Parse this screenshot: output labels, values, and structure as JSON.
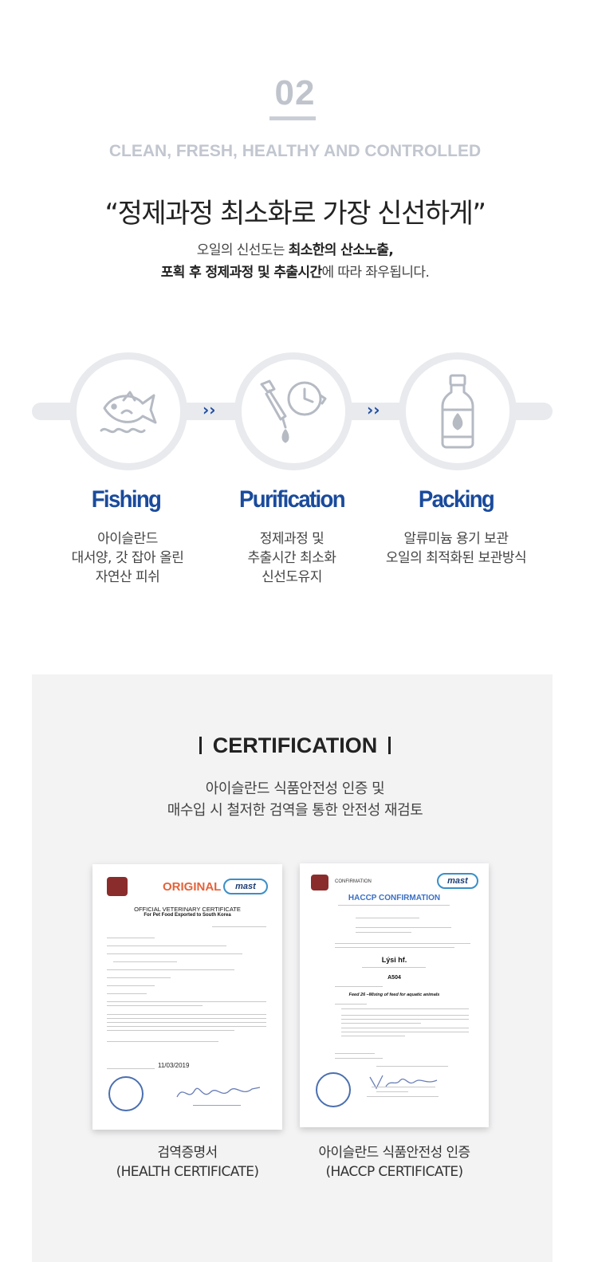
{
  "section": {
    "number": "02",
    "kicker": "CLEAN, FRESH, HEALTHY AND CONTROLLED",
    "headline": "“정제과정 최소화로 가장 신선하게”",
    "sub_line1_plain": "오일의 신선도는 ",
    "sub_line1_bold": "최소한의 산소노출,",
    "sub_line2_bold": "포획 후 정제과정 및 추출시간",
    "sub_line2_plain": "에 따라 좌우됩니다."
  },
  "process": {
    "chevron": "››",
    "steps": [
      {
        "title": "Fishing",
        "icon": "fish-icon",
        "desc": [
          "아이슬란드",
          "대서양, 갓 잡아 올린",
          "자연산 피쉬"
        ]
      },
      {
        "title": "Purification",
        "icon": "dropper-clock-icon",
        "desc": [
          "정제과정 및",
          "추출시간 최소화",
          "신선도유지"
        ]
      },
      {
        "title": "Packing",
        "icon": "bottle-icon",
        "desc": [
          "알류미늄 용기 보관",
          "오일의 최적화된 보관방식"
        ]
      }
    ]
  },
  "certification": {
    "title": "CERTIFICATION",
    "sub": [
      "아이슬란드 식품안전성 인증 및",
      "매수입 시 철저한 검역을 통한 안전성 재검토"
    ],
    "docs": [
      {
        "brand": "ORIGINAL",
        "logo": "mast",
        "heading": "OFFICIAL VETERINARY CERTIFICATE",
        "subheading": "For Pet Food Exported to South Korea",
        "date": "11/03/2019",
        "caption": [
          "검역증명서",
          "(HEALTH CERTIFICATE)"
        ]
      },
      {
        "brand": "CONFIRMATION",
        "logo": "mast",
        "heading": "HACCP CONFIRMATION",
        "company": "Lýsi hf.",
        "code": "A504",
        "product": "Feed 26 –Mixing of feed for aquatic animals",
        "caption": [
          "아이슬란드 식품안전성 인증",
          "(HACCP CERTIFICATE)"
        ]
      }
    ]
  },
  "colors": {
    "accent": "#1a4b9c",
    "muted": "#c1c6cf",
    "panel": "#f3f3f4",
    "track": "#e8eaee"
  }
}
